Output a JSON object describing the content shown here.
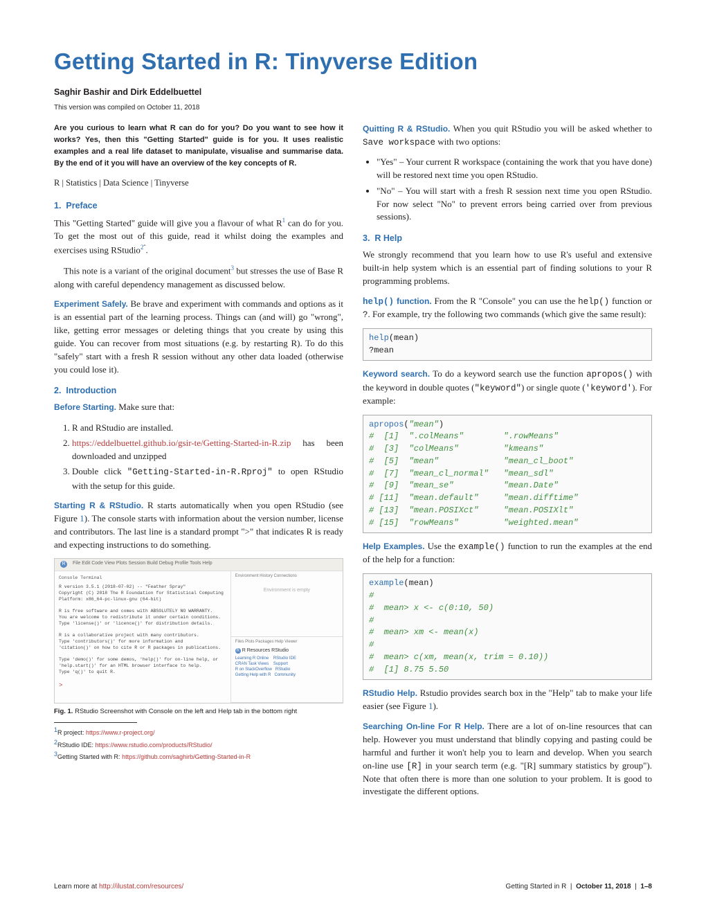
{
  "title": "Getting Started in R: Tinyverse Edition",
  "authors": "Saghir Bashir and Dirk Eddelbuettel",
  "compiled": "This version was compiled on October 11, 2018",
  "abstract": "Are you curious to learn what R can do for you? Do you want to see how it works? Yes, then this \"Getting Started\" guide is for you. It uses realistic examples and a real life dataset to manipulate, visualise and summarise data. By the end of it you will have an overview of the key concepts of R.",
  "tags": "R | Statistics | Data Science | Tinyverse",
  "sec1": {
    "num": "1.",
    "title": "Preface"
  },
  "preface_p1a": "This \"Getting Started\" guide will give you a flavour of what R",
  "preface_p1b": " can do for you. To get the most out of this guide, read it whilst doing the examples and exercises using RStudio",
  "preface_p1c": ".",
  "preface_p2a": "This note is a variant of the original document",
  "preface_p2b": " but stresses the use of Base R along with careful dependency management as discussed below.",
  "expsafe_head": "Experiment Safely.",
  "expsafe_body": " Be brave and experiment with commands and options as it is an essential part of the learning process. Things can (and will) go \"wrong\", like, getting error messages or deleting things that you create by using this guide. You can recover from most situations (e.g. by restarting R). To do this \"safely\" start with a fresh R session without any other data loaded (otherwise you could lose it).",
  "sec2": {
    "num": "2.",
    "title": "Introduction"
  },
  "before_head": "Before Starting.",
  "before_body": " Make sure that:",
  "before_list": {
    "i1": "R and RStudio are installed.",
    "i2a": "https://eddelbuettel.github.io/gsir-te/Getting-Started-in-R.zip",
    "i2b": " has been downloaded and unzipped",
    "i3a": "Double click ",
    "i3b": "\"Getting-Started-in-R.Rproj\"",
    "i3c": " to open RStudio with the setup for this guide."
  },
  "startrr_head": "Starting R & RStudio.",
  "startrr_body": " R starts automatically when you open RStudio (see Figure ",
  "startrr_body2": "). The console starts with information about the version number, license and contributors. The last line is a standard prompt \">\" that indicates R is ready and expecting instructions to do something.",
  "fig1_label": "Fig. 1.",
  "fig1_cap": " RStudio Screenshot with Console on the left and Help tab in the bottom right",
  "footnotes": {
    "f1a": "R project: ",
    "f1b": "https://www.r-project.org/",
    "f2a": "RStudio IDE: ",
    "f2b": "https://www.rstudio.com/products/RStudio/",
    "f3a": "Getting Started with R: ",
    "f3b": "https://github.com/saghirb/Getting-Started-in-R"
  },
  "quit_head": "Quitting R & RStudio.",
  "quit_body": " When you quit RStudio you will be asked whether to ",
  "quit_code": "Save workspace",
  "quit_body2": " with two options:",
  "quit_bullets": {
    "b1": "\"Yes\" – Your current R workspace (containing the work that you have done) will be restored next time you open RStudio.",
    "b2": "\"No\" – You will start with a fresh R session next time you open RStudio. For now select \"No\" to prevent errors being carried over from previous sessions)."
  },
  "sec3": {
    "num": "3.",
    "title": "R Help"
  },
  "rhelp_p1": "We strongly recommend that you learn how to use R's useful and extensive built-in help system which is an essential part of finding solutions to your R programming problems.",
  "helpfn_head": "help() function.",
  "helpfn_body": " From the R \"Console\" you can use the ",
  "helpfn_code1": "help()",
  "helpfn_body2": " function or ",
  "helpfn_code2": "?",
  "helpfn_body3": ". For example, try the following two commands (which give the same result):",
  "code1": "help(mean)\n?mean",
  "kw_head": "Keyword search.",
  "kw_body": " To do a keyword search use the function ",
  "kw_code1": "apropos()",
  "kw_body2": " with the keyword in double quotes (",
  "kw_code2": "\"keyword\"",
  "kw_body3": ") or single quote (",
  "kw_code3": "'keyword'",
  "kw_body4": "). For example:",
  "code2_header": "apropos(\"mean\")",
  "code2_rows": [
    {
      "idx": " [1]",
      "a": "\".colMeans\"",
      "b": "\".rowMeans\""
    },
    {
      "idx": " [3]",
      "a": "\"colMeans\"",
      "b": "\"kmeans\""
    },
    {
      "idx": " [5]",
      "a": "\"mean\"",
      "b": "\"mean_cl_boot\""
    },
    {
      "idx": " [7]",
      "a": "\"mean_cl_normal\"",
      "b": "\"mean_sdl\""
    },
    {
      "idx": " [9]",
      "a": "\"mean_se\"",
      "b": "\"mean.Date\""
    },
    {
      "idx": "[11]",
      "a": "\"mean.default\"",
      "b": "\"mean.difftime\""
    },
    {
      "idx": "[13]",
      "a": "\"mean.POSIXct\"",
      "b": "\"mean.POSIXlt\""
    },
    {
      "idx": "[15]",
      "a": "\"rowMeans\"",
      "b": "\"weighted.mean\""
    }
  ],
  "helpex_head": "Help Examples.",
  "helpex_body": " Use the ",
  "helpex_code": "example()",
  "helpex_body2": " function to run the examples at the end of the help for a function:",
  "code3": "example(mean)\n#\n#  mean> x <- c(0:10, 50)\n#\n#  mean> xm <- mean(x)\n#\n#  mean> c(xm, mean(x, trim = 0.10))\n#  [1] 8.75 5.50",
  "rshelp_head": "RStudio Help.",
  "rshelp_body": " Rstudio provides search box in the \"Help\" tab to make your life easier (see Figure ",
  "rshelp_body2": ").",
  "search_head": "Searching On-line For R Help.",
  "search_body": " There are a lot of on-line resources that can help. However you must understand that blindly copying and pasting could be harmful and further it won't help you to learn and develop. When you search on-line use ",
  "search_code": "[R]",
  "search_body2": " in your search term (e.g. \"[R] summary statistics by group\"). Note that often there is more than one solution to your problem. It is good to investigate the different options.",
  "footer_left_a": "Learn more at ",
  "footer_left_b": "http://ilustat.com/resources/",
  "footer_right": "Getting Started in R   |   October 11, 2018   |   1–8",
  "figmock": {
    "menu": "File  Edit  Code  View  Plots  Session  Build  Debug  Profile  Tools  Help",
    "console1": "R version 3.5.1 (2018-07-02) -- \"Feather Spray\"\nCopyright (C) 2018 The R Foundation for Statistical Computing\nPlatform: x86_64-pc-linux-gnu (64-bit)",
    "console2": "R is free software and comes with ABSOLUTELY NO WARRANTY.\nYou are welcome to redistribute it under certain conditions.\nType 'license()' or 'licence()' for distribution details.",
    "console3": "R is a collaborative project with many contributors.\nType 'contributors()' for more information and\n'citation()' on how to cite R or R packages in publications.",
    "console4": "Type 'demo()' for some demos, 'help()' for on-line help, or\n'help.start()' for an HTML browser interface to help.\nType 'q()' to quit R.",
    "envempty": "Environment is empty",
    "helptitle": "R Resources   RStudio",
    "tabs_tl": "Console   Terminal",
    "tabs_tr": "Environment  History  Connections",
    "tabs_br": "Files  Plots  Packages  Help  Viewer"
  }
}
